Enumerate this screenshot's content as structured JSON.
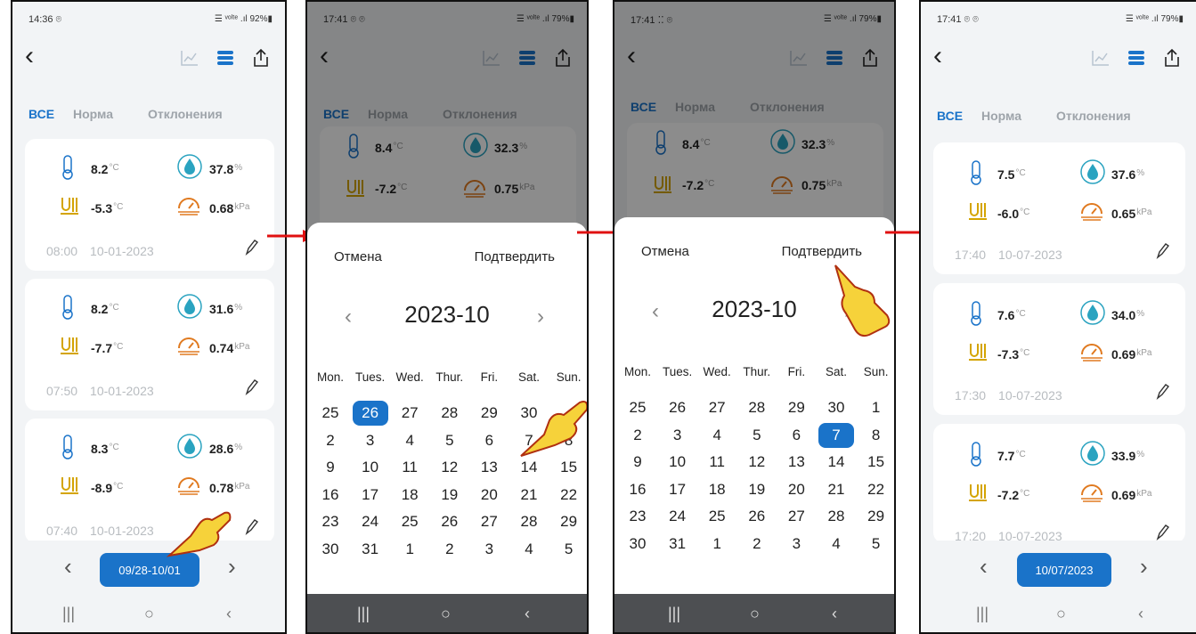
{
  "colors": {
    "accent": "#1a73c9",
    "arrow": "#e01010"
  },
  "panels": [
    {
      "status_time": "14:36 ⌾",
      "status_right": "☰ ᵛᵒˡᵗᵉ .ıl 92%▮",
      "tabs": [
        "ВСЕ",
        "Норма",
        "Отклонения"
      ],
      "cards": [
        {
          "temp": "8.2",
          "hum": "37.8",
          "dew": "-5.3",
          "vpd": "0.68",
          "time": "08:00",
          "date": "10-01-2023"
        },
        {
          "temp": "8.2",
          "hum": "31.6",
          "dew": "-7.7",
          "vpd": "0.74",
          "time": "07:50",
          "date": "10-01-2023"
        },
        {
          "temp": "8.3",
          "hum": "28.6",
          "dew": "-8.9",
          "vpd": "0.78",
          "time": "07:40",
          "date": "10-01-2023"
        }
      ],
      "range_label": "09/28-10/01"
    },
    {
      "status_time": "17:41 ⌾ ⌾",
      "status_right": "☰ ᵛᵒˡᵗᵉ .ıl 79%▮",
      "tabs": [
        "ВСЕ",
        "Норма",
        "Отклонения"
      ],
      "cards": [
        {
          "temp": "8.4",
          "hum": "32.3",
          "dew": "-7.2",
          "vpd": "0.75"
        }
      ],
      "cancel": "Отмена",
      "confirm": "Подтвердить",
      "month": "2023-10",
      "weekdays": [
        "Mon.",
        "Tues.",
        "Wed.",
        "Thur.",
        "Fri.",
        "Sat.",
        "Sun."
      ],
      "weeks": [
        [
          "25",
          "26",
          "27",
          "28",
          "29",
          "30",
          ""
        ],
        [
          "2",
          "3",
          "4",
          "5",
          "6",
          "7",
          "8"
        ],
        [
          "9",
          "10",
          "11",
          "12",
          "13",
          "14",
          "15"
        ],
        [
          "16",
          "17",
          "18",
          "19",
          "20",
          "21",
          "22"
        ],
        [
          "23",
          "24",
          "25",
          "26",
          "27",
          "28",
          "29"
        ],
        [
          "30",
          "31",
          "1",
          "2",
          "3",
          "4",
          "5"
        ]
      ],
      "selected": "26"
    },
    {
      "status_time": "17:41 ⁚⁚ ⌾",
      "status_right": "☰ ᵛᵒˡᵗᵉ .ıl 79%▮",
      "tabs": [
        "ВСЕ",
        "Норма",
        "Отклонения"
      ],
      "cards": [
        {
          "temp": "8.4",
          "hum": "32.3",
          "dew": "-7.2",
          "vpd": "0.75"
        }
      ],
      "cancel": "Отмена",
      "confirm": "Подтвердить",
      "month": "2023-10",
      "weekdays": [
        "Mon.",
        "Tues.",
        "Wed.",
        "Thur.",
        "Fri.",
        "Sat.",
        "Sun."
      ],
      "weeks": [
        [
          "25",
          "26",
          "27",
          "28",
          "29",
          "30",
          "1"
        ],
        [
          "2",
          "3",
          "4",
          "5",
          "6",
          "7",
          "8"
        ],
        [
          "9",
          "10",
          "11",
          "12",
          "13",
          "14",
          "15"
        ],
        [
          "16",
          "17",
          "18",
          "19",
          "20",
          "21",
          "22"
        ],
        [
          "23",
          "24",
          "25",
          "26",
          "27",
          "28",
          "29"
        ],
        [
          "30",
          "31",
          "1",
          "2",
          "3",
          "4",
          "5"
        ]
      ],
      "selected": "7"
    },
    {
      "status_time": "17:41 ⌾ ⌾",
      "status_right": "☰ ᵛᵒˡᵗᵉ .ıl 79%▮",
      "tabs": [
        "ВСЕ",
        "Норма",
        "Отклонения"
      ],
      "cards": [
        {
          "temp": "7.5",
          "hum": "37.6",
          "dew": "-6.0",
          "vpd": "0.65",
          "time": "17:40",
          "date": "10-07-2023"
        },
        {
          "temp": "7.6",
          "hum": "34.0",
          "dew": "-7.3",
          "vpd": "0.69",
          "time": "17:30",
          "date": "10-07-2023"
        },
        {
          "temp": "7.7",
          "hum": "33.9",
          "dew": "-7.2",
          "vpd": "0.69",
          "time": "17:20",
          "date": "10-07-2023"
        }
      ],
      "range_label": "10/07/2023"
    }
  ],
  "units": {
    "temp": "°C",
    "hum": "%",
    "vpd": "kPa"
  },
  "nav": {
    "prev": "‹",
    "next": "›",
    "sys_recent": "|||",
    "sys_home": "○",
    "sys_back": "‹"
  }
}
